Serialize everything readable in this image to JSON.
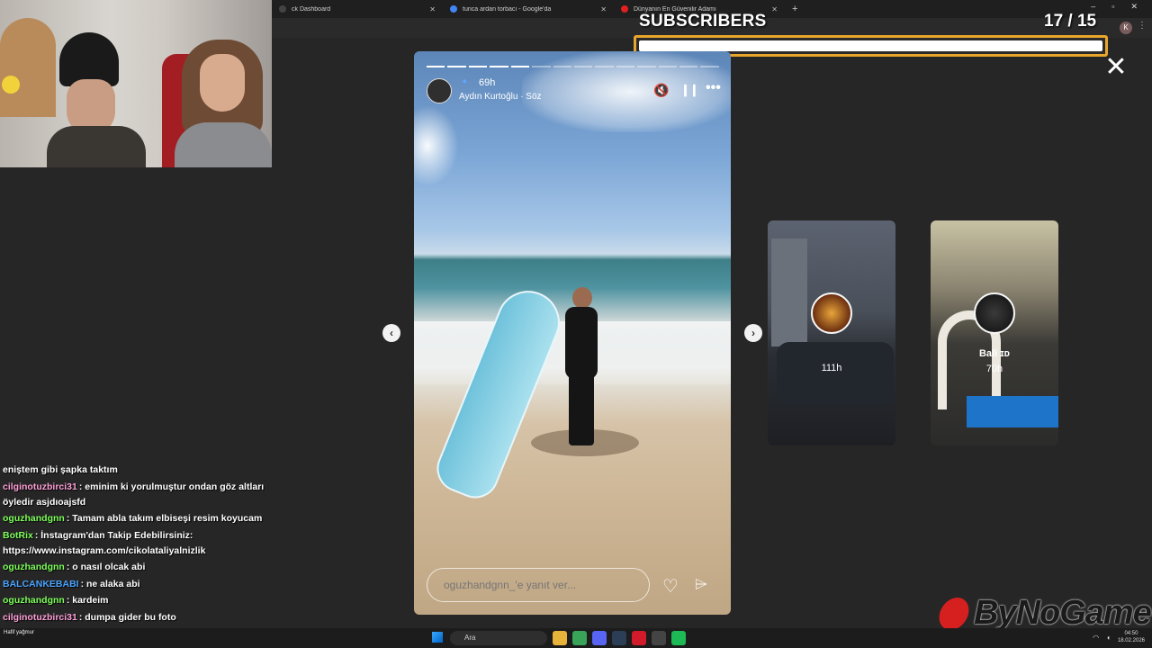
{
  "browser": {
    "tabs": [
      {
        "label": "ck Dashboard",
        "color": "#444444"
      },
      {
        "label": "tunca ardan torbacı - Google'da",
        "color": "#4285f4"
      },
      {
        "label": "Dünyanın En Güvenilir Adamı",
        "color": "#e02020"
      }
    ],
    "new_tab": "+",
    "profile_initial": "K"
  },
  "overlay": {
    "subscribers_title": "SUBSCRIBERS",
    "subscribers_count": "17 / 15",
    "subscribers_progress_pct": 100,
    "bar_color": "#e8a62d"
  },
  "story": {
    "time": "69h",
    "music": "Aydın Kurtoğlu · Söz",
    "segments_total": 14,
    "segments_done": 5,
    "reply_placeholder": "oguzhandgnn_'e yanıt ver...",
    "icons": {
      "mute": "muted-speaker-icon",
      "pause": "pause-icon",
      "more": "more-icon",
      "like": "heart-icon",
      "send": "send-icon"
    }
  },
  "next_stories": [
    {
      "name": "",
      "time": "111h"
    },
    {
      "name": "Bali ɪᴅ",
      "time": "70h"
    }
  ],
  "chat": {
    "messages": [
      {
        "user": "",
        "user_color": "#ffffff",
        "text": "eniştem gibi şapka taktım"
      },
      {
        "user": "cilginotuzbirci31",
        "user_color": "#ff9fd8",
        "text": ": eminim ki yorulmuştur ondan göz altları öyledir asjdıoajsfd"
      },
      {
        "user": "oguzhandgnn",
        "user_color": "#7dff5a",
        "text": ": Tamam abla takım elbiseşi resim koyucam"
      },
      {
        "user": "BotRix",
        "user_color": "#7dff5a",
        "text": ": İnstagram'dan Takip Edebilirsiniz: https://www.instagram.com/cikolataliyalnizlik"
      },
      {
        "user": "oguzhandgnn",
        "user_color": "#7dff5a",
        "text": ": o nasıl olcak abi"
      },
      {
        "user": "BALCANKEBABI",
        "user_color": "#4aa3ff",
        "text": ": ne alaka abi"
      },
      {
        "user": "oguzhandgnn",
        "user_color": "#7dff5a",
        "text": ": kardeim"
      },
      {
        "user": "cilginotuzbirci31",
        "user_color": "#ff9fd8",
        "text": ": dumpa gider bu foto"
      }
    ]
  },
  "logo": {
    "text": "ByNoGame",
    "brand_color": "#d6201f"
  },
  "taskbar": {
    "search_label": "Ara",
    "user_label": "Hafif yağmur",
    "clock_time": "04:50",
    "clock_date": "18.02.2026"
  }
}
